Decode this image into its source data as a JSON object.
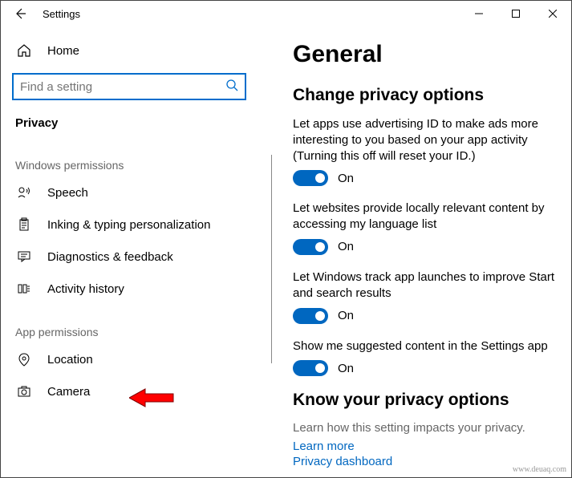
{
  "titlebar": {
    "title": "Settings"
  },
  "sidebar": {
    "home": "Home",
    "search_placeholder": "Find a setting",
    "current": "Privacy",
    "group_windows": "Windows permissions",
    "items_windows": [
      {
        "label": "Speech"
      },
      {
        "label": "Inking & typing personalization"
      },
      {
        "label": "Diagnostics & feedback"
      },
      {
        "label": "Activity history"
      }
    ],
    "group_app": "App permissions",
    "items_app": [
      {
        "label": "Location"
      },
      {
        "label": "Camera"
      }
    ]
  },
  "main": {
    "heading": "General",
    "subheading": "Change privacy options",
    "options": [
      {
        "text": "Let apps use advertising ID to make ads more interesting to you based on your app activity (Turning this off will reset your ID.)",
        "state": "On"
      },
      {
        "text": "Let websites provide locally relevant content by accessing my language list",
        "state": "On"
      },
      {
        "text": "Let Windows track app launches to improve Start and search results",
        "state": "On"
      },
      {
        "text": "Show me suggested content in the Settings app",
        "state": "On"
      }
    ],
    "know_heading": "Know your privacy options",
    "know_desc": "Learn how this setting impacts your privacy.",
    "link_learn": "Learn more",
    "link_dashboard": "Privacy dashboard"
  },
  "watermark": "www.deuaq.com"
}
